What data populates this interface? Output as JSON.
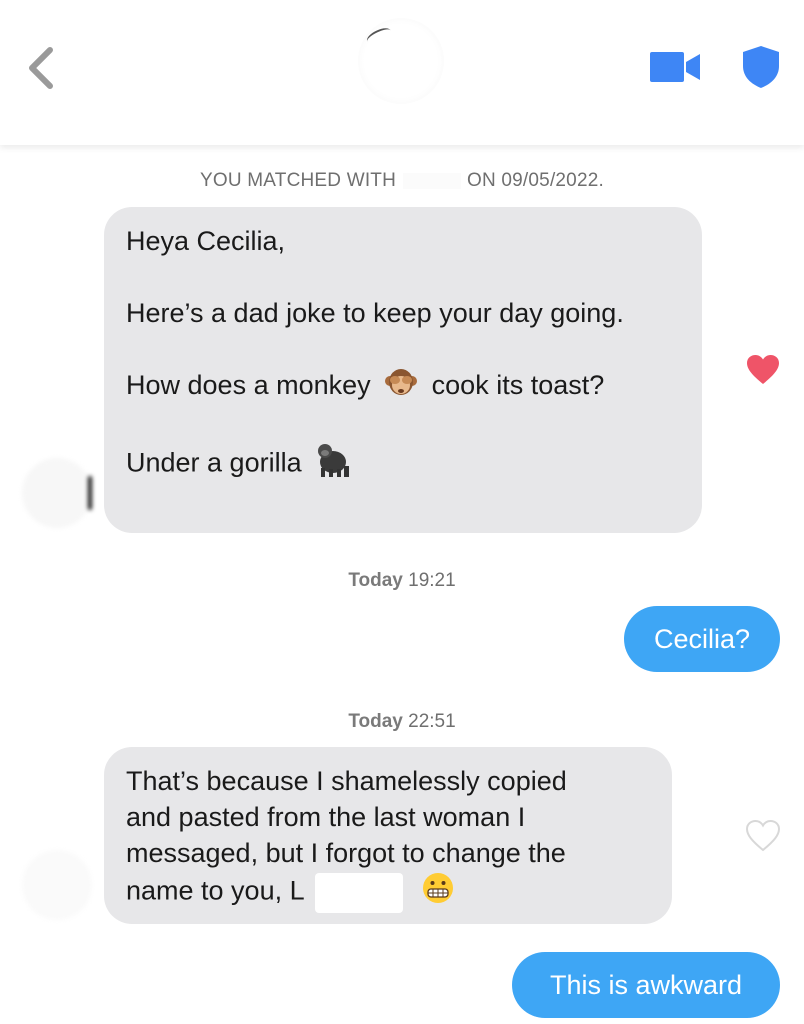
{
  "header": {
    "back_icon": "chevron-left-icon",
    "video_icon": "video-camera-icon",
    "shield_icon": "shield-icon",
    "accent_color": "#3e86f5"
  },
  "match_notice": {
    "prefix": "YOU MATCHED WITH",
    "suffix": "ON 09/05/2022."
  },
  "messages": [
    {
      "direction": "incoming",
      "paragraphs": [
        "Heya Cecilia,",
        "Here’s a dad joke to keep your day going.",
        "How does a monkey",
        "cook its toast?",
        "Under a gorilla"
      ],
      "emojis": [
        "see-no-evil-monkey-emoji",
        "gorilla-emoji"
      ],
      "liked": true
    },
    {
      "timestamp_day": "Today",
      "timestamp_time": "19:21"
    },
    {
      "direction": "outgoing",
      "text": "Cecilia?"
    },
    {
      "timestamp_day": "Today",
      "timestamp_time": "22:51"
    },
    {
      "direction": "incoming",
      "lines": [
        "That’s because I shamelessly copied",
        "and pasted from the last woman I",
        "messaged, but I forgot to change the",
        "name to you, L"
      ],
      "emoji": "grimacing-face-emoji",
      "liked": false
    },
    {
      "direction": "outgoing",
      "text": "This is awkward"
    }
  ],
  "colors": {
    "incoming_bubble": "#e7e7e9",
    "outgoing_bubble": "#3ea6f5",
    "like_heart": "#ef5468",
    "unliked_heart": "#d8d8d8"
  }
}
